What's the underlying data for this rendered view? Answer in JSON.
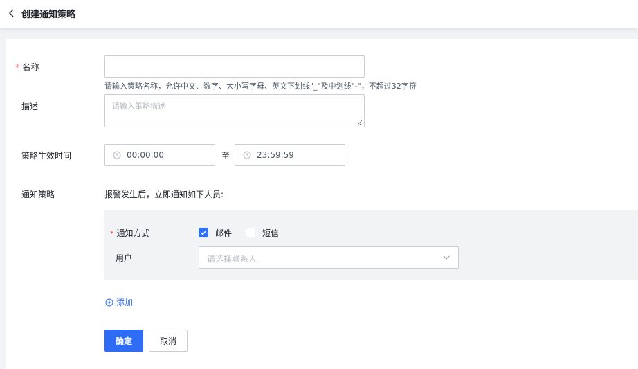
{
  "header": {
    "title": "创建通知策略"
  },
  "form": {
    "name": {
      "label": "名称",
      "required_mark": "*",
      "value": "",
      "hint": "请输入策略名称，允许中文、数字、大小写字母、英文下划线\"_\"及中划线\"-\"，不超过32字符"
    },
    "description": {
      "label": "描述",
      "placeholder": "请输入策略描述"
    },
    "effective_time": {
      "label": "策略生效时间",
      "start": "00:00:00",
      "separator": "至",
      "end": "23:59:59"
    },
    "notify_policy": {
      "label": "通知策略",
      "text": "报警发生后，立即通知如下人员:"
    },
    "notify_method": {
      "label": "通知方式",
      "required_mark": "*",
      "options": [
        {
          "label": "邮件",
          "checked": true
        },
        {
          "label": "短信",
          "checked": false
        }
      ]
    },
    "user": {
      "label": "用户",
      "placeholder": "请选择联系人"
    },
    "add_label": "添加"
  },
  "actions": {
    "confirm": "确定",
    "cancel": "取消"
  },
  "colors": {
    "primary": "#2f6cf6",
    "required": "#f53f3f",
    "panel_bg": "#f2f3f5"
  }
}
